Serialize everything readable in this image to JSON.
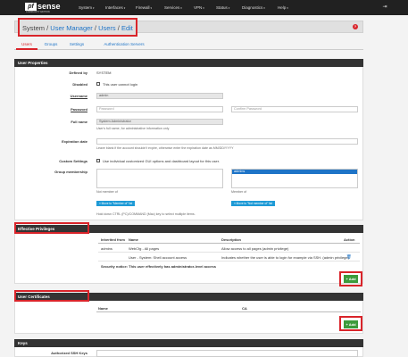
{
  "brand": {
    "logo_box": "pf",
    "logo_text": "sense",
    "edition": "COMMUNITY EDITION"
  },
  "nav": {
    "items": [
      {
        "label": "System"
      },
      {
        "label": "Interfaces"
      },
      {
        "label": "Firewall"
      },
      {
        "label": "Services"
      },
      {
        "label": "VPN"
      },
      {
        "label": "Status"
      },
      {
        "label": "Diagnostics"
      },
      {
        "label": "Help"
      }
    ],
    "logout_icon": "sign-out-icon"
  },
  "breadcrumb": {
    "part1": "System",
    "sep1": " / ",
    "part2": "User Manager",
    "sep2": " / ",
    "part3": "Users",
    "sep3": " / ",
    "part4": "Edit",
    "help_glyph": "?"
  },
  "tabs": [
    {
      "label": "Users",
      "active": true
    },
    {
      "label": "Groups"
    },
    {
      "label": "Settings"
    },
    {
      "label": "Authentication Servers"
    }
  ],
  "user_properties": {
    "heading": "User Properties",
    "defined_by_label": "Defined by",
    "defined_by_value": "SYSTEM",
    "disabled_label": "Disabled",
    "disabled_text": "This user cannot login",
    "username_label": "Username",
    "username_value": "admin",
    "password_label": "Password",
    "password_placeholder": "Password",
    "confirm_placeholder": "Confirm Password",
    "fullname_label": "Full name",
    "fullname_value": "System Administrator",
    "fullname_hint": "User's full name, for administrative information only",
    "expiration_label": "Expiration date",
    "expiration_hint": "Leave blank if the account shouldn't expire, otherwise enter the expiration date as MM/DD/YYYY",
    "custom_label": "Custom Settings",
    "custom_text": "Use individual customized GUI options and dashboard layout for this user.",
    "group_label": "Group membership",
    "group_selected": "admins",
    "not_member_label": "Not member of",
    "member_label": "Member of",
    "move_to_member": "Move to \"Member of\" list",
    "move_to_not_member": "Move to \"Not member of\" list",
    "group_hint": "Hold down CTRL (PC)/COMMAND (Mac) key to select multiple items."
  },
  "effective_privileges": {
    "heading": "Effective Privileges",
    "columns": {
      "inherited": "Inherited from",
      "name": "Name",
      "description": "Description",
      "action": "Action"
    },
    "rows": [
      {
        "inherited": "admins",
        "name": "WebCfg - All pages",
        "description": "Allow access to all pages (admin privilege)"
      },
      {
        "inherited": "",
        "name": "User - System: Shell account access",
        "description": "Indicates whether the user is able to login for example via SSH. (admin privilege)"
      }
    ],
    "notice": "Security notice: This user effectively has administrator-level access",
    "add_label": "+ Add"
  },
  "user_certificates": {
    "heading": "User Certificates",
    "columns": {
      "name": "Name",
      "ca": "CA"
    },
    "add_label": "+ Add"
  },
  "keys": {
    "heading": "Keys",
    "authorized_label": "Authorized SSH Keys"
  }
}
